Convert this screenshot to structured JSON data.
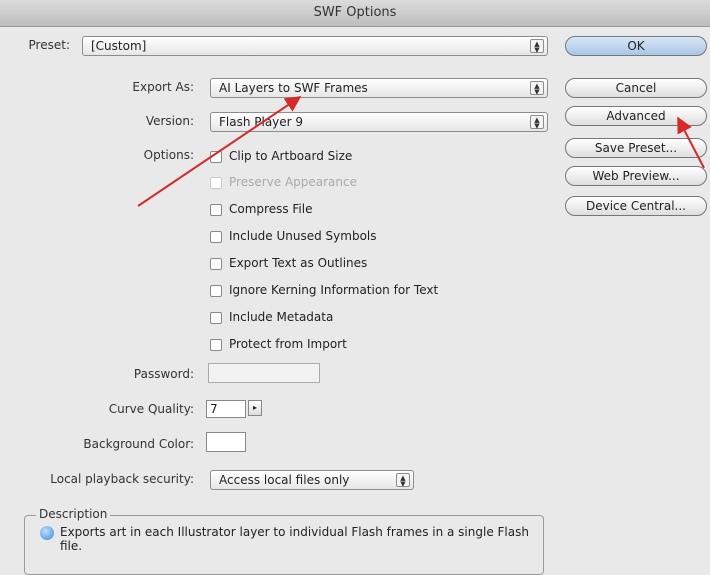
{
  "window": {
    "title": "SWF Options"
  },
  "preset": {
    "label": "Preset:",
    "value": "[Custom]"
  },
  "export_as": {
    "label": "Export As:",
    "value": "AI Layers to SWF Frames"
  },
  "version": {
    "label": "Version:",
    "value": "Flash Player 9"
  },
  "options": {
    "label": "Options:",
    "items": [
      {
        "label": "Clip to Artboard Size",
        "checked": false,
        "enabled": true
      },
      {
        "label": "Preserve Appearance",
        "checked": false,
        "enabled": false
      },
      {
        "label": "Compress File",
        "checked": false,
        "enabled": true
      },
      {
        "label": "Include Unused Symbols",
        "checked": false,
        "enabled": true
      },
      {
        "label": "Export Text as Outlines",
        "checked": false,
        "enabled": true
      },
      {
        "label": "Ignore Kerning Information for Text",
        "checked": false,
        "enabled": true
      },
      {
        "label": "Include Metadata",
        "checked": false,
        "enabled": true
      },
      {
        "label": "Protect from Import",
        "checked": false,
        "enabled": true
      }
    ]
  },
  "password": {
    "label": "Password:",
    "value": ""
  },
  "curve_quality": {
    "label": "Curve Quality:",
    "value": "7"
  },
  "background_color": {
    "label": "Background Color:",
    "value": "#ffffff"
  },
  "local_playback": {
    "label": "Local playback security:",
    "value": "Access local files only"
  },
  "buttons": {
    "ok": "OK",
    "cancel": "Cancel",
    "advanced": "Advanced",
    "save_preset": "Save Preset...",
    "web_preview": "Web Preview...",
    "device_central": "Device Central..."
  },
  "description": {
    "title": "Description",
    "text": "Exports art in each Illustrator layer to individual Flash frames in a single Flash file."
  },
  "annotation_color": "#d42a2a"
}
